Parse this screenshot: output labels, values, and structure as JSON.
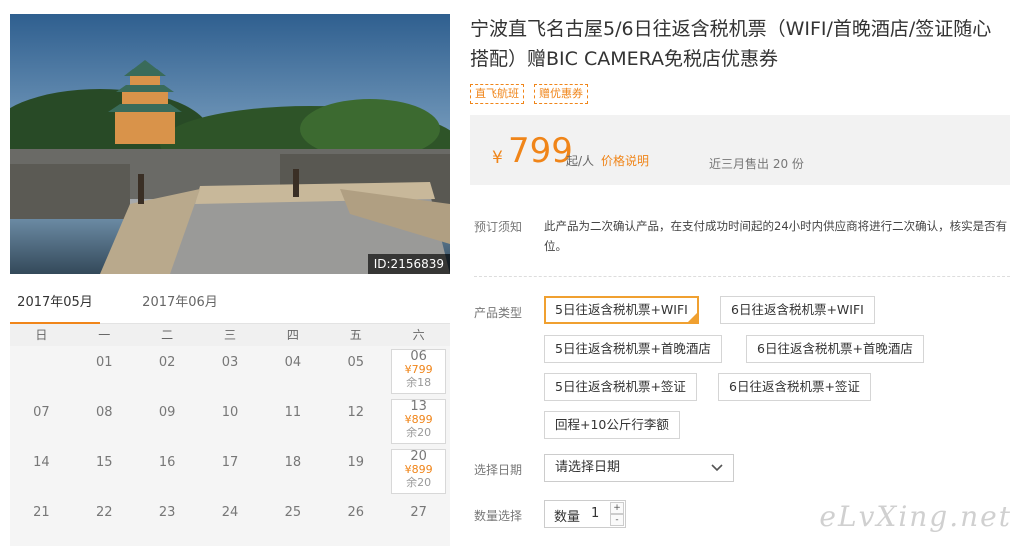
{
  "product": {
    "title": "宁波直飞名古屋5/6日往返含税机票（WIFI/首晚酒店/签证随心搭配）赠BIC CAMERA免税店优惠券",
    "photo_id": "ID:2156839",
    "tags": [
      "直飞航班",
      "赠优惠券"
    ]
  },
  "price": {
    "currency": "¥",
    "amount": "799",
    "unit": "起/人",
    "explain": "价格说明",
    "sold": "近三月售出 20 份"
  },
  "notice": {
    "label": "预订须知",
    "text": "此产品为二次确认产品，在支付成功时间起的24小时内供应商将进行二次确认，核实是否有位。"
  },
  "options": {
    "label": "产品类型",
    "items": [
      "5日往返含税机票+WIFI",
      "6日往返含税机票+WIFI",
      "5日往返含税机票+首晚酒店",
      "6日往返含税机票+首晚酒店",
      "5日往返含税机票+签证",
      "6日往返含税机票+签证",
      "回程+10公斤行李额"
    ]
  },
  "date_select": {
    "label": "选择日期",
    "placeholder": "请选择日期"
  },
  "quantity": {
    "label": "数量选择",
    "field_label": "数量",
    "value": "1",
    "plus": "+",
    "minus": "-"
  },
  "calendar": {
    "months": [
      "2017年05月",
      "2017年06月"
    ],
    "weekdays": [
      "日",
      "一",
      "二",
      "三",
      "四",
      "五",
      "六"
    ],
    "rows": [
      [
        {
          "d": ""
        },
        {
          "d": "01"
        },
        {
          "d": "02"
        },
        {
          "d": "03"
        },
        {
          "d": "04"
        },
        {
          "d": "05"
        },
        {
          "d": "06",
          "price": "¥799",
          "stock": "余18"
        }
      ],
      [
        {
          "d": "07"
        },
        {
          "d": "08"
        },
        {
          "d": "09"
        },
        {
          "d": "10"
        },
        {
          "d": "11"
        },
        {
          "d": "12"
        },
        {
          "d": "13",
          "price": "¥899",
          "stock": "余20"
        }
      ],
      [
        {
          "d": "14"
        },
        {
          "d": "15"
        },
        {
          "d": "16"
        },
        {
          "d": "17"
        },
        {
          "d": "18"
        },
        {
          "d": "19"
        },
        {
          "d": "20",
          "price": "¥899",
          "stock": "余20"
        }
      ],
      [
        {
          "d": "21"
        },
        {
          "d": "22"
        },
        {
          "d": "23"
        },
        {
          "d": "24"
        },
        {
          "d": "25"
        },
        {
          "d": "26"
        },
        {
          "d": "27"
        }
      ]
    ]
  },
  "watermark": "eLvXing.net",
  "colors": {
    "accent": "#f08519",
    "selected_border": "#f0a030"
  }
}
